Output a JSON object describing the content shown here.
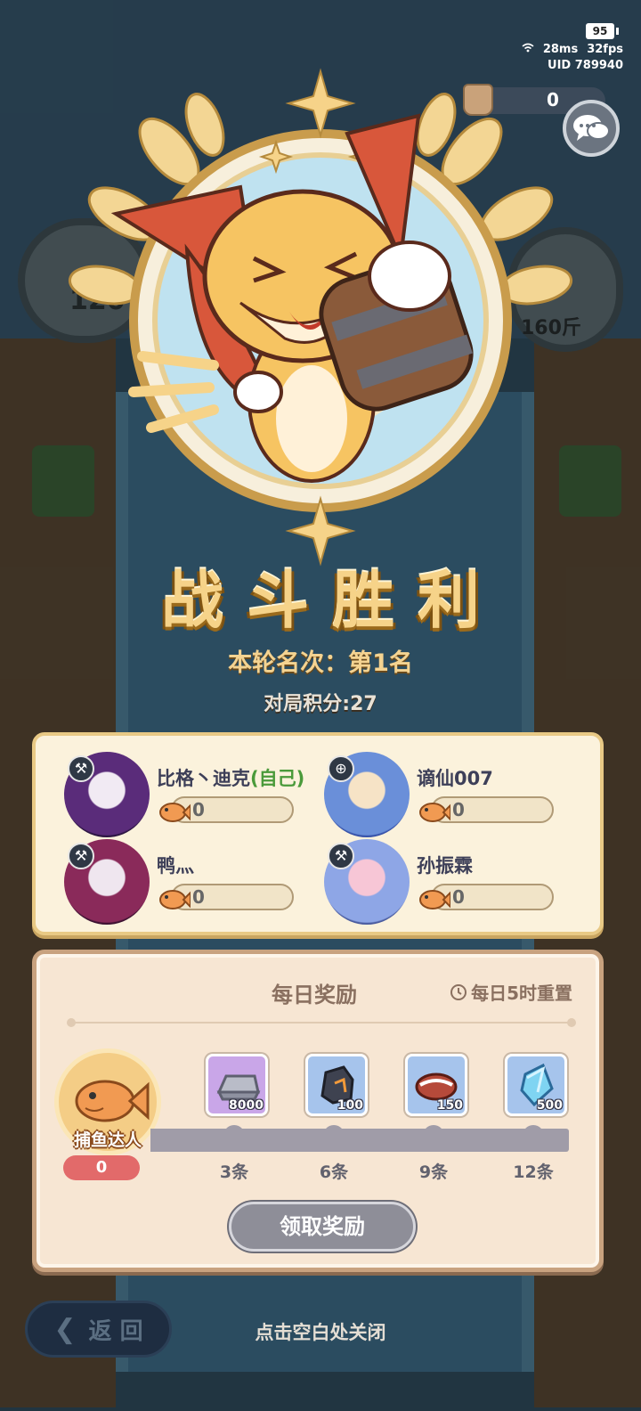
{
  "hud": {
    "battery": "95",
    "ping": "28ms",
    "fps": "32fps",
    "uid": "UID  789940"
  },
  "currency": {
    "value": "0"
  },
  "background": {
    "bubble_left_value": "120",
    "bubble_right_value": "160斤",
    "return_label": "返 回"
  },
  "result": {
    "title": "战斗胜利",
    "rank": "本轮名次：第1名",
    "score": "对局积分:27"
  },
  "players": [
    {
      "name": "比格丶迪克",
      "self_tag": "(自己)",
      "fish": "0"
    },
    {
      "name": "谪仙007",
      "self_tag": "",
      "fish": "0"
    },
    {
      "name": "鸭灬",
      "self_tag": "",
      "fish": "0"
    },
    {
      "name": "孙振霖",
      "self_tag": "",
      "fish": "0"
    }
  ],
  "daily_reward": {
    "title": "每日奖励",
    "reset_text": "每日5时重置",
    "master_label": "捕鱼达人",
    "master_count": "0",
    "progress": 0,
    "items": [
      {
        "icon": "silver-ingot-icon",
        "qty": "8000",
        "color": "#c9a6e8"
      },
      {
        "icon": "ore-stone-icon",
        "qty": "100",
        "color": "#a6c4ec"
      },
      {
        "icon": "meat-icon",
        "qty": "150",
        "color": "#a6c4ec"
      },
      {
        "icon": "blue-crystal-icon",
        "qty": "500",
        "color": "#a6c4ec"
      }
    ],
    "milestones": [
      "3条",
      "6条",
      "9条",
      "12条"
    ],
    "claim_label": "领取奖励"
  },
  "close_hint": "点击空白处关闭",
  "colors": {
    "gold": "#f6d389",
    "panel": "#fbf2dc",
    "reward_panel": "#f7e6d3",
    "self_tag": "#4a9a3a",
    "count_badge": "#e26a6a",
    "disabled_button": "#8e8e98"
  }
}
